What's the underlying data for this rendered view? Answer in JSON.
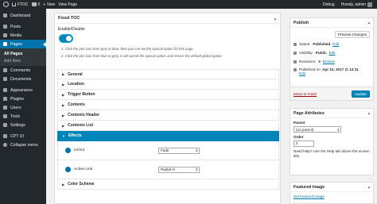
{
  "adminbar": {
    "site": "FTOC",
    "comments_count": "0",
    "new": "New",
    "view_page": "View Page",
    "debug": "Debug",
    "howdy": "Howdy, admin"
  },
  "sidebar": {
    "items": [
      {
        "label": "Dashboard"
      },
      {
        "label": "Posts"
      },
      {
        "label": "Media"
      },
      {
        "label": "Pages"
      },
      {
        "label": "Comments"
      },
      {
        "label": "Documents"
      },
      {
        "label": "Appearance"
      },
      {
        "label": "Plugins"
      },
      {
        "label": "Users"
      },
      {
        "label": "Tools"
      },
      {
        "label": "Settings"
      },
      {
        "label": "CPT UI"
      },
      {
        "label": "Collapse menu"
      }
    ],
    "submenu": [
      "All Pages",
      "Add New"
    ]
  },
  "toc_panel": {
    "title": "Fixed TOC",
    "enable_label": "Enable/Disable",
    "hint1": "1. Click the pen icon from grey to blue, then you can set the special option for this page.",
    "hint2": "2. Click the pen icon from blue to grey, it will cancel the special option and restore the default global option.",
    "sections": [
      "General",
      "Location",
      "Trigger Button",
      "Contents",
      "Contents Header",
      "Contents List",
      "Effects"
    ],
    "effects": [
      {
        "label": "In/Out",
        "value": "Fade"
      },
      {
        "label": "Active Link",
        "value": "Radial In"
      }
    ],
    "last_section": "Color Scheme"
  },
  "publish": {
    "title": "Publish",
    "preview": "Preview Changes",
    "status_label": "Status:",
    "status_value": "Published",
    "visibility_label": "Visibility:",
    "visibility_value": "Public",
    "revisions_label": "Revisions:",
    "revisions_value": "3",
    "browse": "Browse",
    "published_on": "Published on:",
    "published_date": "Apr 10, 2017 @ 13:11",
    "edit": "Edit",
    "trash": "Move to Trash",
    "update": "Update"
  },
  "page_attributes": {
    "title": "Page Attributes",
    "parent_label": "Parent",
    "parent_value": "(no parent)",
    "order_label": "Order",
    "order_value": "0",
    "help": "Need help? Use the Help tab above the screen title."
  },
  "featured_image": {
    "title": "Featured Image",
    "link": "Set featured image"
  }
}
